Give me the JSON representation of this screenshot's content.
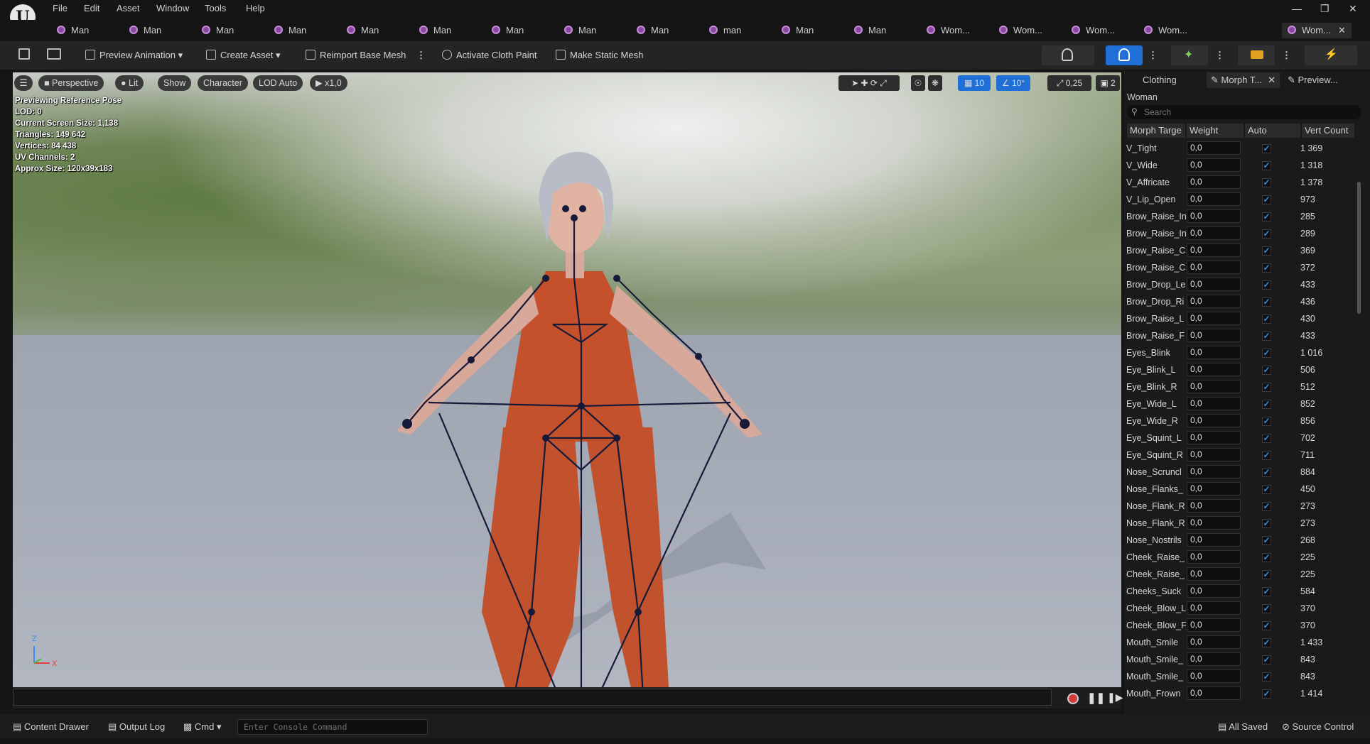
{
  "menu": [
    "File",
    "Edit",
    "Asset",
    "Window",
    "Tools",
    "Help"
  ],
  "tabs": [
    "Man",
    "Man",
    "Man",
    "Man",
    "Man",
    "Man",
    "Man",
    "Man",
    "Man",
    "man",
    "Man",
    "Man",
    "Wom...",
    "Wom...",
    "Wom...",
    "Wom...",
    "Wom..."
  ],
  "toolbar": {
    "preview_animation": "Preview Animation",
    "create_asset": "Create Asset",
    "reimport": "Reimport Base Mesh",
    "cloth_paint": "Activate Cloth Paint",
    "static_mesh": "Make Static Mesh"
  },
  "viewport": {
    "perspective": "Perspective",
    "lit": "Lit",
    "show": "Show",
    "character": "Character",
    "lod": "LOD Auto",
    "speed": "x1,0",
    "grid": "10",
    "angle": "10°",
    "scale": "0,25",
    "cam": "2",
    "info": [
      "Previewing Reference Pose",
      "LOD: 0",
      "Current Screen Size: 1,138",
      "Triangles: 149 642",
      "Vertices: 84 438",
      "UV Channels: 2",
      "Approx Size: 120x39x183"
    ],
    "axis_z": "Z",
    "axis_x": "X"
  },
  "panel": {
    "tabs": [
      "Clothing",
      "Morph T...",
      "Preview..."
    ],
    "asset": "Woman",
    "search_placeholder": "Search",
    "columns": [
      "Morph Targe",
      "Weight",
      "Auto",
      "Vert Count"
    ],
    "rows": [
      {
        "name": "V_Tight",
        "weight": "0,0",
        "vc": "1 369"
      },
      {
        "name": "V_Wide",
        "weight": "0,0",
        "vc": "1 318"
      },
      {
        "name": "V_Affricate",
        "weight": "0,0",
        "vc": "1 378"
      },
      {
        "name": "V_Lip_Open",
        "weight": "0,0",
        "vc": "973"
      },
      {
        "name": "Brow_Raise_In",
        "weight": "0,0",
        "vc": "285"
      },
      {
        "name": "Brow_Raise_In",
        "weight": "0,0",
        "vc": "289"
      },
      {
        "name": "Brow_Raise_C",
        "weight": "0,0",
        "vc": "369"
      },
      {
        "name": "Brow_Raise_C",
        "weight": "0,0",
        "vc": "372"
      },
      {
        "name": "Brow_Drop_Le",
        "weight": "0,0",
        "vc": "433"
      },
      {
        "name": "Brow_Drop_Ri",
        "weight": "0,0",
        "vc": "436"
      },
      {
        "name": "Brow_Raise_L",
        "weight": "0,0",
        "vc": "430"
      },
      {
        "name": "Brow_Raise_F",
        "weight": "0,0",
        "vc": "433"
      },
      {
        "name": "Eyes_Blink",
        "weight": "0,0",
        "vc": "1 016"
      },
      {
        "name": "Eye_Blink_L",
        "weight": "0,0",
        "vc": "506"
      },
      {
        "name": "Eye_Blink_R",
        "weight": "0,0",
        "vc": "512"
      },
      {
        "name": "Eye_Wide_L",
        "weight": "0,0",
        "vc": "852"
      },
      {
        "name": "Eye_Wide_R",
        "weight": "0,0",
        "vc": "856"
      },
      {
        "name": "Eye_Squint_L",
        "weight": "0,0",
        "vc": "702"
      },
      {
        "name": "Eye_Squint_R",
        "weight": "0,0",
        "vc": "711"
      },
      {
        "name": "Nose_Scruncl",
        "weight": "0,0",
        "vc": "884"
      },
      {
        "name": "Nose_Flanks_",
        "weight": "0,0",
        "vc": "450"
      },
      {
        "name": "Nose_Flank_R",
        "weight": "0,0",
        "vc": "273"
      },
      {
        "name": "Nose_Flank_R",
        "weight": "0,0",
        "vc": "273"
      },
      {
        "name": "Nose_Nostrils",
        "weight": "0,0",
        "vc": "268"
      },
      {
        "name": "Cheek_Raise_",
        "weight": "0,0",
        "vc": "225"
      },
      {
        "name": "Cheek_Raise_",
        "weight": "0,0",
        "vc": "225"
      },
      {
        "name": "Cheeks_Suck",
        "weight": "0,0",
        "vc": "584"
      },
      {
        "name": "Cheek_Blow_L",
        "weight": "0,0",
        "vc": "370"
      },
      {
        "name": "Cheek_Blow_F",
        "weight": "0,0",
        "vc": "370"
      },
      {
        "name": "Mouth_Smile",
        "weight": "0,0",
        "vc": "1 433"
      },
      {
        "name": "Mouth_Smile_",
        "weight": "0,0",
        "vc": "843"
      },
      {
        "name": "Mouth_Smile_",
        "weight": "0,0",
        "vc": "843"
      },
      {
        "name": "Mouth_Frown",
        "weight": "0,0",
        "vc": "1 414"
      }
    ]
  },
  "status": {
    "content_drawer": "Content Drawer",
    "output_log": "Output Log",
    "cmd": "Cmd",
    "console_placeholder": "Enter Console Command",
    "all_saved": "All Saved",
    "source_control": "Source Control"
  },
  "colors": {
    "accent": "#1f6fd6",
    "check": "#3e8ee0",
    "tabicon": "#8a4aa0"
  }
}
